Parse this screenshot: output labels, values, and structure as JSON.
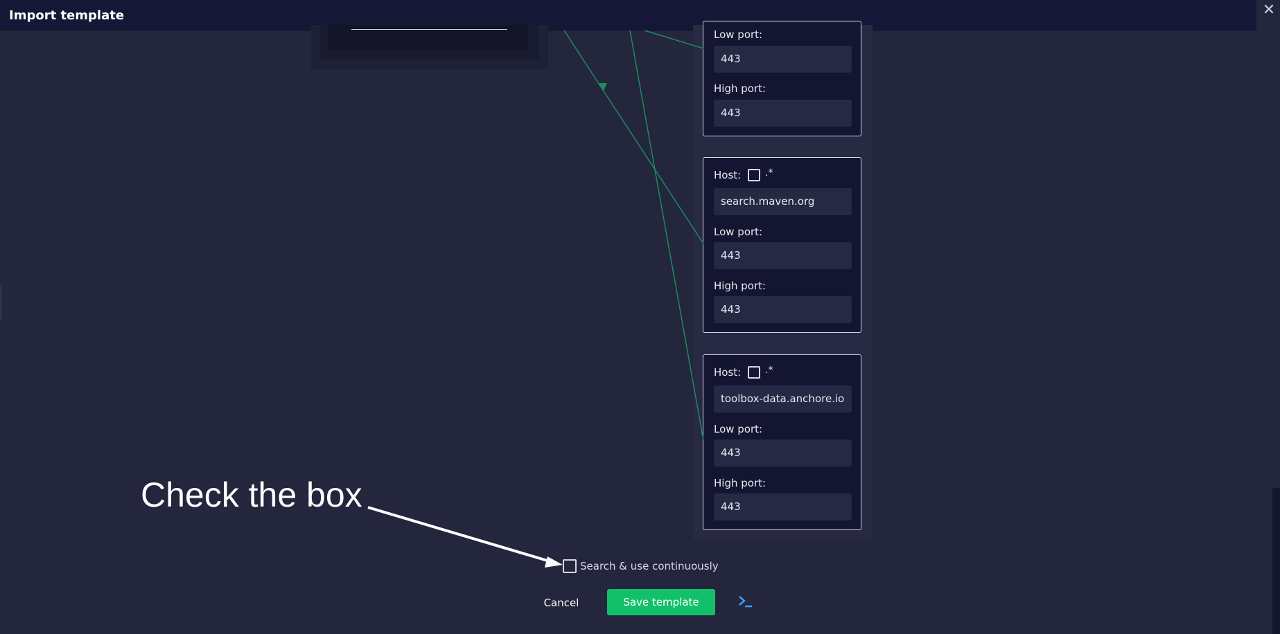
{
  "window": {
    "title": "Import template",
    "close_glyph": "✕"
  },
  "hosts": [
    {
      "partial": true,
      "low_port_label": "Low port:",
      "low_port": "443",
      "high_port_label": "High port:",
      "high_port": "443"
    },
    {
      "host_label": "Host:",
      "regex_label": ".*",
      "regex_checked": false,
      "host": "search.maven.org",
      "low_port_label": "Low port:",
      "low_port": "443",
      "high_port_label": "High port:",
      "high_port": "443"
    },
    {
      "host_label": "Host:",
      "regex_label": ".*",
      "regex_checked": false,
      "host": "toolbox-data.anchore.io",
      "low_port_label": "Low port:",
      "low_port": "443",
      "high_port_label": "High port:",
      "high_port": "443"
    }
  ],
  "annotation": {
    "text": "Check the box"
  },
  "footer": {
    "search_label": "Search & use continuously",
    "search_checked": false,
    "cancel_label": "Cancel",
    "save_label": "Save template",
    "terminal_icon": "terminal-icon"
  },
  "colors": {
    "background": "#23263d",
    "titlebar": "#141735",
    "accent": "#13c06a",
    "connector": "#1f8a5e",
    "terminal": "#3aa0ff"
  }
}
